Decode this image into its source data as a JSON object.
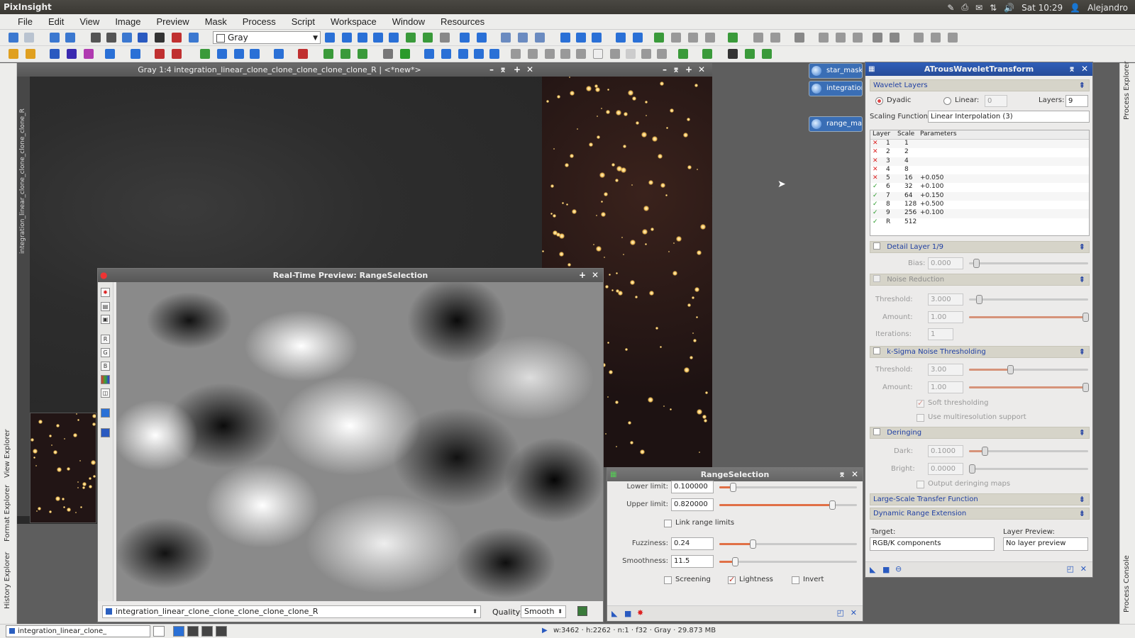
{
  "system_bar": {
    "app_name": "PixInsight",
    "clock": "Sat 10:29",
    "user": "Alejandro"
  },
  "menu": [
    "File",
    "Edit",
    "View",
    "Image",
    "Preview",
    "Mask",
    "Process",
    "Script",
    "Workspace",
    "Window",
    "Resources"
  ],
  "toolbar": {
    "colorspace_select": "Gray"
  },
  "main_window": {
    "title": "Gray 1:4 integration_linear_clone_clone_clone_clone_clone_R | <*new*>",
    "side_label": "integration_linear_clone_clone_clone_clone_R"
  },
  "desktop_icons": [
    "star_mask",
    "integration_",
    "range_mask"
  ],
  "left_strip": [
    "View Explorer",
    "Format Explorer",
    "History Explorer"
  ],
  "right_strip": [
    "Process Explorer",
    "Process Console"
  ],
  "realtime_preview": {
    "title": "Real-Time Preview: RangeSelection",
    "tool_letters": [
      "R",
      "G",
      "B"
    ],
    "view_select": "integration_linear_clone_clone_clone_clone_clone_R",
    "quality_label": "Quality:",
    "quality_value": "Smooth"
  },
  "range_selection": {
    "title": "RangeSelection",
    "lower_limit_label": "Lower limit:",
    "lower_limit": "0.100000",
    "upper_limit_label": "Upper limit:",
    "upper_limit": "0.820000",
    "link_label": "Link range limits",
    "fuzziness_label": "Fuzziness:",
    "fuzziness": "0.24",
    "smoothness_label": "Smoothness:",
    "smoothness": "11.5",
    "screening_label": "Screening",
    "lightness_label": "Lightness",
    "invert_label": "Invert",
    "sliders": {
      "lower": 0.1,
      "upper": 0.82,
      "fuzziness": 0.24,
      "smoothness": 0.115
    }
  },
  "atrous": {
    "title": "ATrousWaveletTransform",
    "wavelet_layers": "Wavelet Layers",
    "dyadic": "Dyadic",
    "linear": "Linear:",
    "linear_value": "0",
    "layers_label": "Layers:",
    "layers_value": "9",
    "scaling_label": "Scaling Function:",
    "scaling_value": "Linear Interpolation (3)",
    "table_headers": [
      "Layer",
      "Scale",
      "Parameters"
    ],
    "rows": [
      {
        "on": false,
        "layer": "1",
        "scale": "1",
        "param": ""
      },
      {
        "on": false,
        "layer": "2",
        "scale": "2",
        "param": ""
      },
      {
        "on": false,
        "layer": "3",
        "scale": "4",
        "param": ""
      },
      {
        "on": false,
        "layer": "4",
        "scale": "8",
        "param": ""
      },
      {
        "on": false,
        "layer": "5",
        "scale": "16",
        "param": "+0.050"
      },
      {
        "on": true,
        "layer": "6",
        "scale": "32",
        "param": "+0.100"
      },
      {
        "on": true,
        "layer": "7",
        "scale": "64",
        "param": "+0.150"
      },
      {
        "on": true,
        "layer": "8",
        "scale": "128",
        "param": "+0.500"
      },
      {
        "on": true,
        "layer": "9",
        "scale": "256",
        "param": "+0.100"
      },
      {
        "on": true,
        "layer": "R",
        "scale": "512",
        "param": ""
      }
    ],
    "detail_layer": "Detail Layer 1/9",
    "bias_label": "Bias:",
    "bias": "0.000",
    "noise_reduction": "Noise Reduction",
    "threshold_label": "Threshold:",
    "nr_threshold": "3.000",
    "amount_label": "Amount:",
    "nr_amount": "1.00",
    "iterations_label": "Iterations:",
    "iterations": "1",
    "ksigma": "k-Sigma Noise Thresholding",
    "ks_threshold": "3.00",
    "ks_amount": "1.00",
    "soft_thresholding": "Soft thresholding",
    "multiresolution": "Use multiresolution support",
    "deringing": "Deringing",
    "dark_label": "Dark:",
    "dark": "0.1000",
    "bright_label": "Bright:",
    "bright": "0.0000",
    "output_deringing": "Output deringing maps",
    "large_scale": "Large-Scale Transfer Function",
    "dynamic_range": "Dynamic Range Extension",
    "target_label": "Target:",
    "target_value": "RGB/K components",
    "layer_preview_label": "Layer Preview:",
    "layer_preview_value": "No layer preview"
  },
  "status_bar": {
    "view": "integration_linear_clone_",
    "info": "w:3462 · h:2262 · n:1 · f32 · Gray · 29.873 MB"
  }
}
